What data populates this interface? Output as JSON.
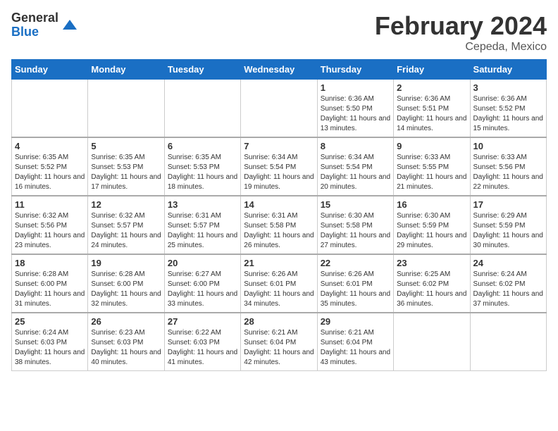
{
  "header": {
    "logo_general": "General",
    "logo_blue": "Blue",
    "month_year": "February 2024",
    "location": "Cepeda, Mexico"
  },
  "days_of_week": [
    "Sunday",
    "Monday",
    "Tuesday",
    "Wednesday",
    "Thursday",
    "Friday",
    "Saturday"
  ],
  "weeks": [
    [
      {
        "day": "",
        "sunrise": "",
        "sunset": "",
        "daylight": ""
      },
      {
        "day": "",
        "sunrise": "",
        "sunset": "",
        "daylight": ""
      },
      {
        "day": "",
        "sunrise": "",
        "sunset": "",
        "daylight": ""
      },
      {
        "day": "",
        "sunrise": "",
        "sunset": "",
        "daylight": ""
      },
      {
        "day": "1",
        "sunrise": "Sunrise: 6:36 AM",
        "sunset": "Sunset: 5:50 PM",
        "daylight": "Daylight: 11 hours and 13 minutes."
      },
      {
        "day": "2",
        "sunrise": "Sunrise: 6:36 AM",
        "sunset": "Sunset: 5:51 PM",
        "daylight": "Daylight: 11 hours and 14 minutes."
      },
      {
        "day": "3",
        "sunrise": "Sunrise: 6:36 AM",
        "sunset": "Sunset: 5:52 PM",
        "daylight": "Daylight: 11 hours and 15 minutes."
      }
    ],
    [
      {
        "day": "4",
        "sunrise": "Sunrise: 6:35 AM",
        "sunset": "Sunset: 5:52 PM",
        "daylight": "Daylight: 11 hours and 16 minutes."
      },
      {
        "day": "5",
        "sunrise": "Sunrise: 6:35 AM",
        "sunset": "Sunset: 5:53 PM",
        "daylight": "Daylight: 11 hours and 17 minutes."
      },
      {
        "day": "6",
        "sunrise": "Sunrise: 6:35 AM",
        "sunset": "Sunset: 5:53 PM",
        "daylight": "Daylight: 11 hours and 18 minutes."
      },
      {
        "day": "7",
        "sunrise": "Sunrise: 6:34 AM",
        "sunset": "Sunset: 5:54 PM",
        "daylight": "Daylight: 11 hours and 19 minutes."
      },
      {
        "day": "8",
        "sunrise": "Sunrise: 6:34 AM",
        "sunset": "Sunset: 5:54 PM",
        "daylight": "Daylight: 11 hours and 20 minutes."
      },
      {
        "day": "9",
        "sunrise": "Sunrise: 6:33 AM",
        "sunset": "Sunset: 5:55 PM",
        "daylight": "Daylight: 11 hours and 21 minutes."
      },
      {
        "day": "10",
        "sunrise": "Sunrise: 6:33 AM",
        "sunset": "Sunset: 5:56 PM",
        "daylight": "Daylight: 11 hours and 22 minutes."
      }
    ],
    [
      {
        "day": "11",
        "sunrise": "Sunrise: 6:32 AM",
        "sunset": "Sunset: 5:56 PM",
        "daylight": "Daylight: 11 hours and 23 minutes."
      },
      {
        "day": "12",
        "sunrise": "Sunrise: 6:32 AM",
        "sunset": "Sunset: 5:57 PM",
        "daylight": "Daylight: 11 hours and 24 minutes."
      },
      {
        "day": "13",
        "sunrise": "Sunrise: 6:31 AM",
        "sunset": "Sunset: 5:57 PM",
        "daylight": "Daylight: 11 hours and 25 minutes."
      },
      {
        "day": "14",
        "sunrise": "Sunrise: 6:31 AM",
        "sunset": "Sunset: 5:58 PM",
        "daylight": "Daylight: 11 hours and 26 minutes."
      },
      {
        "day": "15",
        "sunrise": "Sunrise: 6:30 AM",
        "sunset": "Sunset: 5:58 PM",
        "daylight": "Daylight: 11 hours and 27 minutes."
      },
      {
        "day": "16",
        "sunrise": "Sunrise: 6:30 AM",
        "sunset": "Sunset: 5:59 PM",
        "daylight": "Daylight: 11 hours and 29 minutes."
      },
      {
        "day": "17",
        "sunrise": "Sunrise: 6:29 AM",
        "sunset": "Sunset: 5:59 PM",
        "daylight": "Daylight: 11 hours and 30 minutes."
      }
    ],
    [
      {
        "day": "18",
        "sunrise": "Sunrise: 6:28 AM",
        "sunset": "Sunset: 6:00 PM",
        "daylight": "Daylight: 11 hours and 31 minutes."
      },
      {
        "day": "19",
        "sunrise": "Sunrise: 6:28 AM",
        "sunset": "Sunset: 6:00 PM",
        "daylight": "Daylight: 11 hours and 32 minutes."
      },
      {
        "day": "20",
        "sunrise": "Sunrise: 6:27 AM",
        "sunset": "Sunset: 6:00 PM",
        "daylight": "Daylight: 11 hours and 33 minutes."
      },
      {
        "day": "21",
        "sunrise": "Sunrise: 6:26 AM",
        "sunset": "Sunset: 6:01 PM",
        "daylight": "Daylight: 11 hours and 34 minutes."
      },
      {
        "day": "22",
        "sunrise": "Sunrise: 6:26 AM",
        "sunset": "Sunset: 6:01 PM",
        "daylight": "Daylight: 11 hours and 35 minutes."
      },
      {
        "day": "23",
        "sunrise": "Sunrise: 6:25 AM",
        "sunset": "Sunset: 6:02 PM",
        "daylight": "Daylight: 11 hours and 36 minutes."
      },
      {
        "day": "24",
        "sunrise": "Sunrise: 6:24 AM",
        "sunset": "Sunset: 6:02 PM",
        "daylight": "Daylight: 11 hours and 37 minutes."
      }
    ],
    [
      {
        "day": "25",
        "sunrise": "Sunrise: 6:24 AM",
        "sunset": "Sunset: 6:03 PM",
        "daylight": "Daylight: 11 hours and 38 minutes."
      },
      {
        "day": "26",
        "sunrise": "Sunrise: 6:23 AM",
        "sunset": "Sunset: 6:03 PM",
        "daylight": "Daylight: 11 hours and 40 minutes."
      },
      {
        "day": "27",
        "sunrise": "Sunrise: 6:22 AM",
        "sunset": "Sunset: 6:03 PM",
        "daylight": "Daylight: 11 hours and 41 minutes."
      },
      {
        "day": "28",
        "sunrise": "Sunrise: 6:21 AM",
        "sunset": "Sunset: 6:04 PM",
        "daylight": "Daylight: 11 hours and 42 minutes."
      },
      {
        "day": "29",
        "sunrise": "Sunrise: 6:21 AM",
        "sunset": "Sunset: 6:04 PM",
        "daylight": "Daylight: 11 hours and 43 minutes."
      },
      {
        "day": "",
        "sunrise": "",
        "sunset": "",
        "daylight": ""
      },
      {
        "day": "",
        "sunrise": "",
        "sunset": "",
        "daylight": ""
      }
    ]
  ]
}
